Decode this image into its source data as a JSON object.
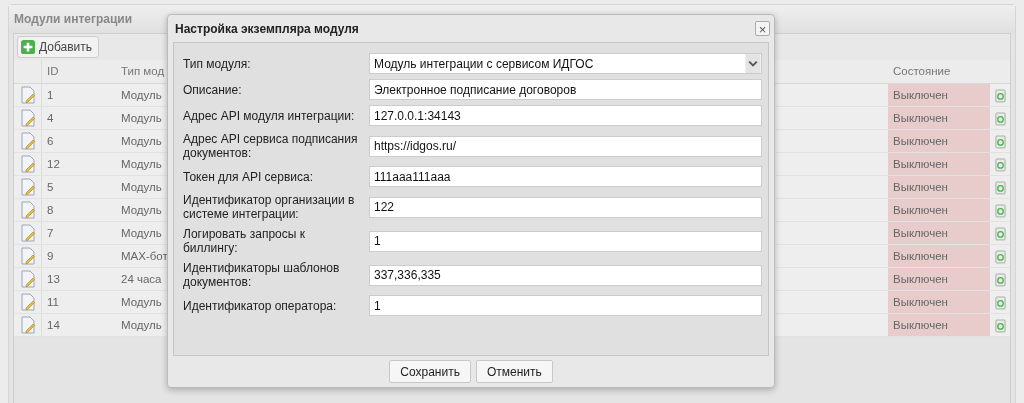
{
  "panel": {
    "title": "Модули интеграции",
    "add_button": "Добавить"
  },
  "table": {
    "columns": [
      "ID",
      "Тип мод",
      "Состояние"
    ],
    "rows": [
      {
        "id": "1",
        "type": "Модуль",
        "status": "Выключен",
        "enabled": false
      },
      {
        "id": "4",
        "type": "Модуль",
        "status": "Выключен",
        "enabled": false
      },
      {
        "id": "6",
        "type": "Модуль",
        "status": "Выключен",
        "enabled": false
      },
      {
        "id": "12",
        "type": "Модуль",
        "status": "Выключен",
        "enabled": false
      },
      {
        "id": "5",
        "type": "Модуль",
        "status": "Выключен",
        "enabled": false
      },
      {
        "id": "8",
        "type": "Модуль",
        "status": "Выключен",
        "enabled": false
      },
      {
        "id": "7",
        "type": "Модуль",
        "status": "Выключен",
        "enabled": false
      },
      {
        "id": "9",
        "type": "MAX-бот",
        "status": "Выключен",
        "enabled": false
      },
      {
        "id": "13",
        "type": "24 часа",
        "status": "Выключен",
        "enabled": false
      },
      {
        "id": "11",
        "type": "Модуль",
        "status": "Выключен",
        "enabled": false
      },
      {
        "id": "14",
        "type": "Модуль",
        "status": "Выключен",
        "enabled": false
      }
    ]
  },
  "dialog": {
    "title": "Настройка экземпляра модуля",
    "close": "×",
    "fields": [
      {
        "kind": "select",
        "label": "Тип модуля:",
        "value": "Модуль интеграции с сервисом ИДГОС"
      },
      {
        "kind": "text",
        "label": "Описание:",
        "value": "Электронное подписание договоров"
      },
      {
        "kind": "text",
        "label": "Адрес API модуля интеграции:",
        "value": "127.0.0.1:34143"
      },
      {
        "kind": "text",
        "label": "Адрес API сервиса подписания документов:",
        "value": "https://idgos.ru/"
      },
      {
        "kind": "text",
        "label": "Токен для API сервиса:",
        "value": "111aaa111aaa"
      },
      {
        "kind": "text",
        "label": "Идентификатор организации в системе интеграции:",
        "value": "122"
      },
      {
        "kind": "text",
        "label": "Логировать запросы к биллингу:",
        "value": "1"
      },
      {
        "kind": "text",
        "label": "Идентификаторы шаблонов документов:",
        "value": "337,336,335"
      },
      {
        "kind": "text",
        "label": "Идентификатор оператора:",
        "value": "1"
      }
    ],
    "buttons": [
      "Сохранить",
      "Отменить"
    ]
  }
}
